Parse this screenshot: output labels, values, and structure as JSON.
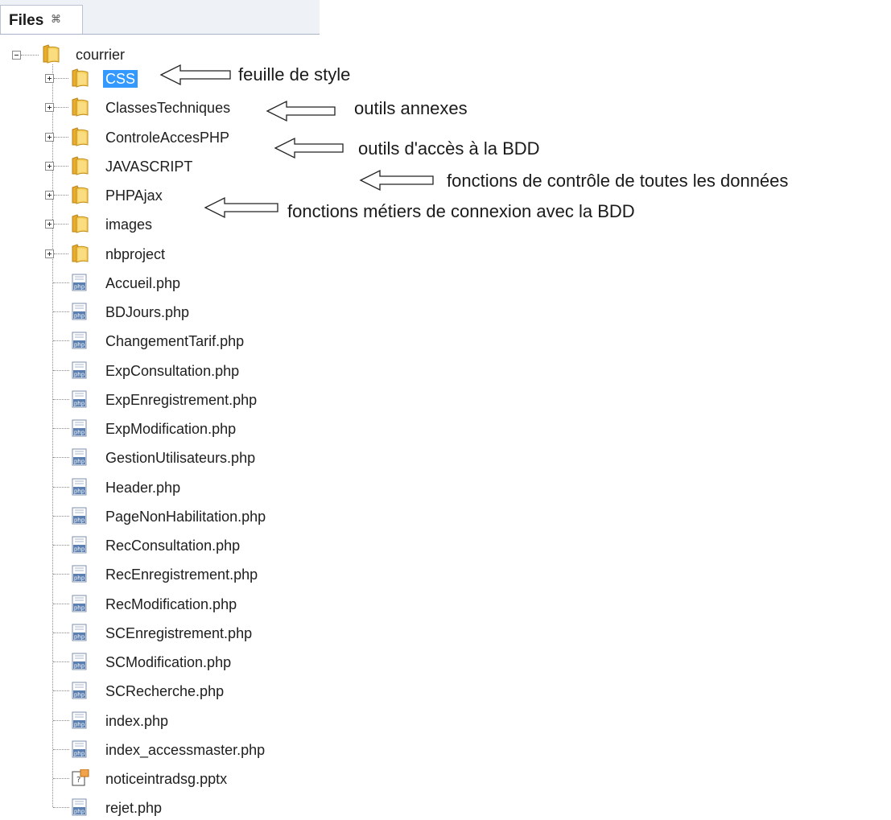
{
  "tab": {
    "title": "Files",
    "close": "⌘"
  },
  "root": {
    "label": "courrier"
  },
  "folders": [
    {
      "label": "CSS",
      "selected": true
    },
    {
      "label": "ClassesTechniques"
    },
    {
      "label": "ControleAccesPHP"
    },
    {
      "label": "JAVASCRIPT"
    },
    {
      "label": "PHPAjax"
    },
    {
      "label": "images"
    },
    {
      "label": "nbproject"
    }
  ],
  "files": [
    {
      "label": "Accueil.php",
      "icon": "php-file-icon"
    },
    {
      "label": "BDJours.php",
      "icon": "php-file-icon"
    },
    {
      "label": "ChangementTarif.php",
      "icon": "php-file-icon"
    },
    {
      "label": "ExpConsultation.php",
      "icon": "php-file-icon"
    },
    {
      "label": "ExpEnregistrement.php",
      "icon": "php-file-icon"
    },
    {
      "label": "ExpModification.php",
      "icon": "php-file-icon"
    },
    {
      "label": "GestionUtilisateurs.php",
      "icon": "php-file-icon"
    },
    {
      "label": "Header.php",
      "icon": "php-file-icon"
    },
    {
      "label": "PageNonHabilitation.php",
      "icon": "php-file-icon"
    },
    {
      "label": "RecConsultation.php",
      "icon": "php-file-icon"
    },
    {
      "label": "RecEnregistrement.php",
      "icon": "php-file-icon"
    },
    {
      "label": "RecModification.php",
      "icon": "php-file-icon"
    },
    {
      "label": "SCEnregistrement.php",
      "icon": "php-file-icon"
    },
    {
      "label": "SCModification.php",
      "icon": "php-file-icon"
    },
    {
      "label": "SCRecherche.php",
      "icon": "php-file-icon"
    },
    {
      "label": "index.php",
      "icon": "php-file-icon"
    },
    {
      "label": "index_accessmaster.php",
      "icon": "php-file-icon"
    },
    {
      "label": "noticeintradsg.pptx",
      "icon": "pptx-file-icon"
    },
    {
      "label": "rejet.php",
      "icon": "php-file-icon"
    }
  ],
  "annotations": [
    {
      "text": "feuille de style",
      "target": "CSS"
    },
    {
      "text": "outils annexes",
      "target": "ClassesTechniques"
    },
    {
      "text": "outils d'accès à la BDD",
      "target": "ControleAccesPHP"
    },
    {
      "text": "fonctions de contrôle de toutes les données",
      "target": "JAVASCRIPT"
    },
    {
      "text": "fonctions métiers  de connexion avec la BDD",
      "target": "PHPAjax"
    }
  ],
  "colors": {
    "selection": "#3399ff",
    "folder": "#f3c24a",
    "tabbar": "#eef1f6"
  }
}
